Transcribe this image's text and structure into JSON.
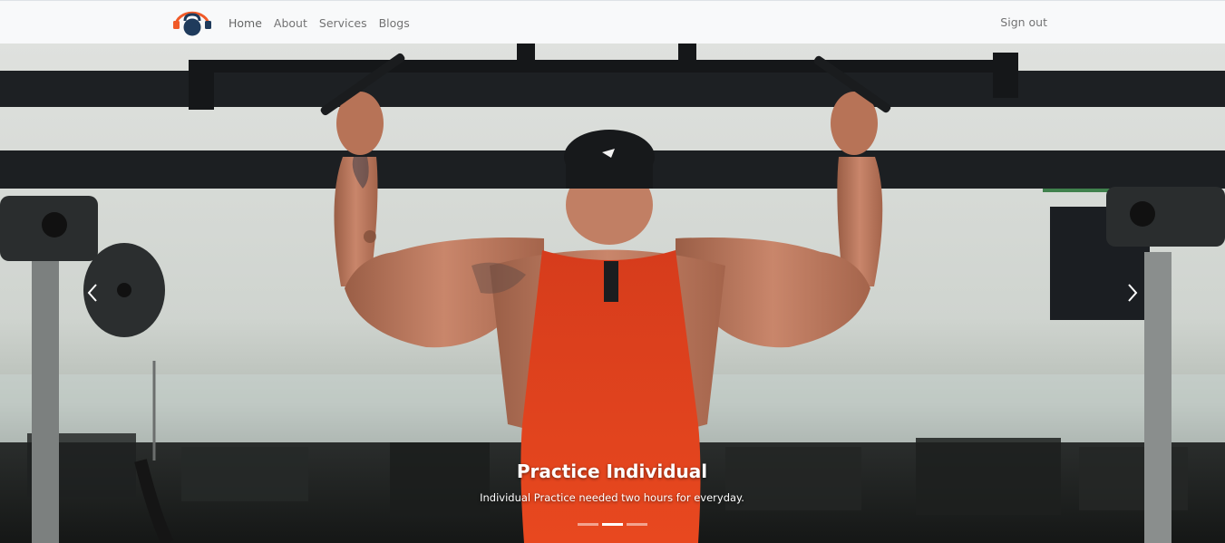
{
  "navbar": {
    "brand_icon": "kettlebell-logo-icon",
    "links": [
      "Home",
      "About",
      "Services",
      "Blogs"
    ],
    "signout_label": "Sign out"
  },
  "carousel": {
    "background_image": "man doing pull-ups in gym",
    "prev_icon": "chevron-left-icon",
    "next_icon": "chevron-right-icon",
    "slide": {
      "title": "Practice Individual",
      "text": "Individual Practice needed two hours for everyday."
    },
    "indicator_count": 3,
    "active_indicator": 2
  },
  "colors": {
    "navbar_bg": "#f8f9fa",
    "brand_orange": "#f05a28",
    "brand_navy": "#1f3b5c",
    "tank_top": "#e2401e"
  }
}
